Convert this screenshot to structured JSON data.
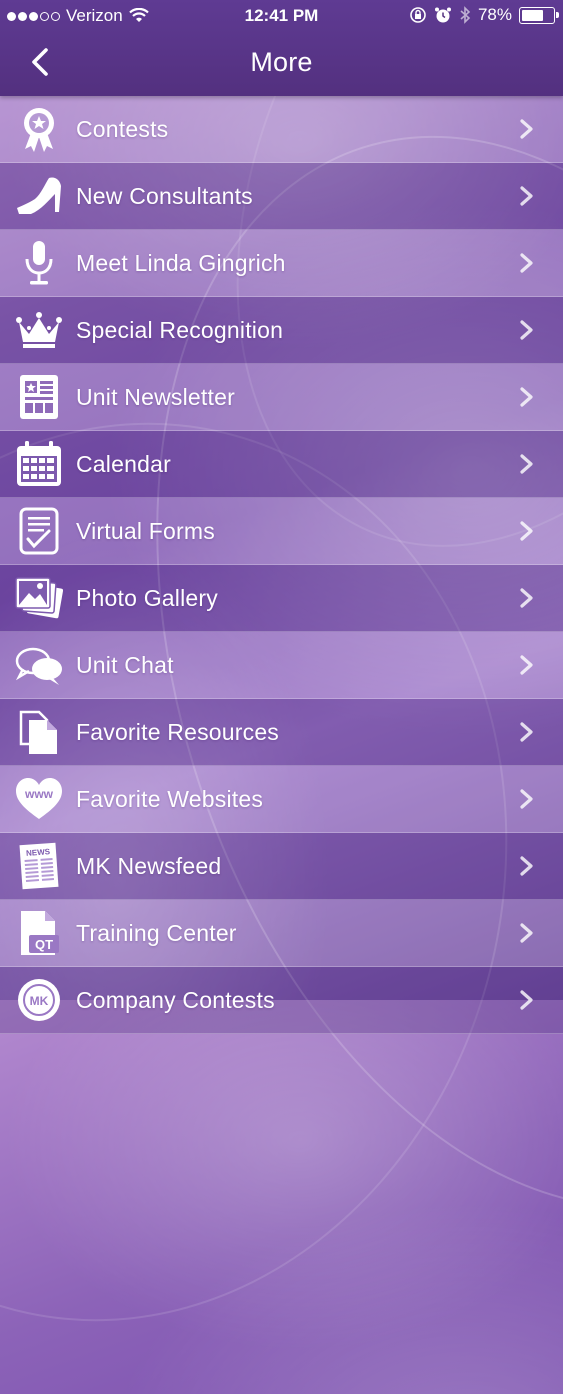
{
  "status_bar": {
    "carrier": "Verizon",
    "time": "12:41 PM",
    "battery_percent": "78%",
    "battery_level": 0.78
  },
  "nav": {
    "title": "More",
    "back_icon": "chevron-left-icon"
  },
  "menu": {
    "items": [
      {
        "label": "Contests",
        "icon": "award-ribbon-icon"
      },
      {
        "label": "New Consultants",
        "icon": "high-heel-icon"
      },
      {
        "label": "Meet Linda Gingrich",
        "icon": "microphone-icon"
      },
      {
        "label": "Special Recognition",
        "icon": "crown-icon"
      },
      {
        "label": "Unit Newsletter",
        "icon": "newsletter-icon"
      },
      {
        "label": "Calendar",
        "icon": "calendar-icon"
      },
      {
        "label": "Virtual Forms",
        "icon": "form-checkmark-icon"
      },
      {
        "label": "Photo Gallery",
        "icon": "photo-gallery-icon"
      },
      {
        "label": "Unit Chat",
        "icon": "chat-bubbles-icon"
      },
      {
        "label": "Favorite Resources",
        "icon": "documents-icon"
      },
      {
        "label": "Favorite Websites",
        "icon": "www-heart-icon"
      },
      {
        "label": "MK Newsfeed",
        "icon": "newspaper-icon"
      },
      {
        "label": "Training Center",
        "icon": "qt-document-icon"
      },
      {
        "label": "Company Contests",
        "icon": "mk-badge-icon"
      }
    ],
    "chevron_icon": "chevron-right-icon"
  },
  "colors": {
    "header": "#5a3689",
    "background": "#8c63b8",
    "text": "#ffffff"
  }
}
